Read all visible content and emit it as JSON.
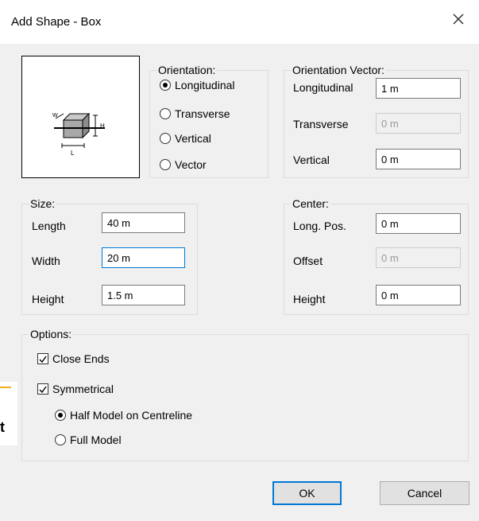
{
  "dialog": {
    "title": "Add Shape - Box"
  },
  "background": {
    "fragment_text": "t"
  },
  "orientation": {
    "legend": "Orientation:",
    "options": [
      "Longitudinal",
      "Transverse",
      "Vertical",
      "Vector"
    ],
    "selected": "Longitudinal"
  },
  "orientation_vector": {
    "legend": "Orientation Vector:",
    "longitudinal_label": "Longitudinal",
    "longitudinal_value": "1 m",
    "transverse_label": "Transverse",
    "transverse_value": "0 m",
    "vertical_label": "Vertical",
    "vertical_value": "0 m"
  },
  "size": {
    "legend": "Size:",
    "length_label": "Length",
    "length_value": "40 m",
    "width_label": "Width",
    "width_value": "20 m",
    "height_label": "Height",
    "height_value": "1.5 m"
  },
  "center": {
    "legend": "Center:",
    "long_pos_label": "Long. Pos.",
    "long_pos_value": "0 m",
    "offset_label": "Offset",
    "offset_value": "0 m",
    "height_label": "Height",
    "height_value": "0 m"
  },
  "options": {
    "legend": "Options:",
    "close_ends_label": "Close Ends",
    "close_ends_checked": true,
    "symmetrical_label": "Symmetrical",
    "symmetrical_checked": true,
    "half_model_label": "Half Model on Centreline",
    "full_model_label": "Full Model",
    "model_selected": "half"
  },
  "preview": {
    "w_label": "W",
    "h_label": "H",
    "l_label": "L"
  },
  "buttons": {
    "ok": "OK",
    "cancel": "Cancel"
  },
  "icons": {
    "close": "close-icon",
    "box_preview": "box-preview-icon"
  }
}
